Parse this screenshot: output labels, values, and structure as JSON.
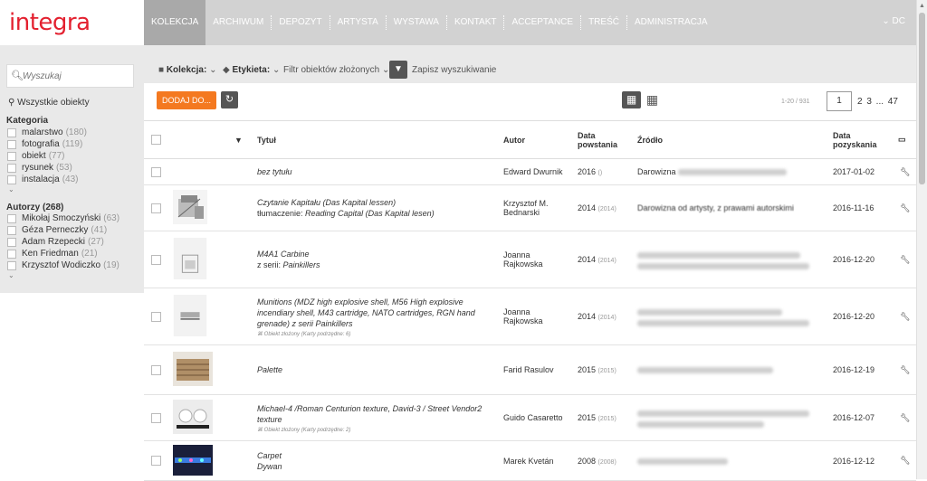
{
  "app": {
    "logo": "integra"
  },
  "nav": {
    "items": [
      "KOLEKCJA",
      "ARCHIWUM",
      "DEPOZYT",
      "ARTYSTA",
      "WYSTAWA",
      "KONTAKT",
      "ACCEPTANCE",
      "TREŚĆ",
      "ADMINISTRACJA"
    ],
    "user": "DC"
  },
  "sidebar": {
    "search_placeholder": "Wyszukaj",
    "all_objects": "Wszystkie obiekty",
    "category_title": "Kategoria",
    "categories": [
      {
        "label": "malarstwo",
        "count": "(180)"
      },
      {
        "label": "fotografia",
        "count": "(119)"
      },
      {
        "label": "obiekt",
        "count": "(77)"
      },
      {
        "label": "rysunek",
        "count": "(53)"
      },
      {
        "label": "instalacja",
        "count": "(43)"
      }
    ],
    "authors_title": "Autorzy (268)",
    "authors": [
      {
        "label": "Mikołaj Smoczyński",
        "count": "(63)"
      },
      {
        "label": "Géza Perneczky",
        "count": "(41)"
      },
      {
        "label": "Adam Rzepecki",
        "count": "(27)"
      },
      {
        "label": "Ken Friedman",
        "count": "(21)"
      },
      {
        "label": "Krzysztof Wodiczko",
        "count": "(19)"
      }
    ]
  },
  "toolbar": {
    "collection": "Kolekcja:",
    "label": "Etykieta:",
    "filter_complex": "Filtr obiektów złożonych",
    "save_search": "Zapisz wyszukiwanie"
  },
  "actions": {
    "add": "DODAJ DO...",
    "range": "1-20 / 931",
    "page_current": "1",
    "pages": "2  3  ...  47"
  },
  "table": {
    "headers": {
      "title": "Tytuł",
      "author": "Autor",
      "date_created": "Data powstania",
      "source": "Źródło",
      "date_acquired": "Data pozyskania"
    },
    "rows": [
      {
        "title": "bez tytułu",
        "author": "Edward Dwurnik",
        "year": "2016",
        "year_sub": "()",
        "source": "Darowizna",
        "acq": "2017-01-02"
      },
      {
        "title": "Czytanie Kapitału (Das Kapital lessen)",
        "title2_prefix": "tłumaczenie: ",
        "title2": "Reading Capital (Das Kapital lesen)",
        "author": "Krzysztof M. Bednarski",
        "year": "2014",
        "year_sub": "(2014)",
        "source": "Darowizna od artysty, z prawami autorskimi",
        "acq": "2016-11-16"
      },
      {
        "title": "M4A1 Carbine",
        "title2_prefix": "z serii: ",
        "title2": "Painkillers",
        "author": "Joanna Rajkowska",
        "year": "2014",
        "year_sub": "(2014)",
        "source": "",
        "acq": "2016-12-20"
      },
      {
        "title": "Munitions (MDZ high explosive shell, M56 High explosive incendiary shell, M43 cartridge, NATO cartridges, RGN hand grenade) z serii Painkillers",
        "sub": "Obiekt złożony (Karty podrzędne: 6)",
        "author": "Joanna Rajkowska",
        "year": "2014",
        "year_sub": "(2014)",
        "source": "",
        "acq": "2016-12-20"
      },
      {
        "title": "Palette",
        "author": "Farid Rasulov",
        "year": "2015",
        "year_sub": "(2015)",
        "source": "",
        "acq": "2016-12-19"
      },
      {
        "title": "Michael-4 /Roman Centurion texture, David-3 / Street Vendor2 texture",
        "sub": "Obiekt złożony (Karty podrzędne: 2)",
        "author": "Guido Casaretto",
        "year": "2015",
        "year_sub": "(2015)",
        "source": "",
        "acq": "2016-12-07"
      },
      {
        "title": "Carpet",
        "title_line2": "Dywan",
        "author": "Marek Kvetán",
        "year": "2008",
        "year_sub": "(2008)",
        "source": "",
        "acq": "2016-12-12"
      }
    ]
  }
}
